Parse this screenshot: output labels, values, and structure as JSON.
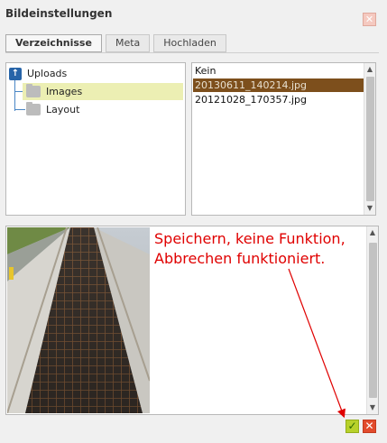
{
  "dialog": {
    "title": "Bildeinstellungen",
    "close_glyph": "✕"
  },
  "tabs": [
    {
      "label": "Verzeichnisse",
      "active": true
    },
    {
      "label": "Meta",
      "active": false
    },
    {
      "label": "Hochladen",
      "active": false
    }
  ],
  "tree": {
    "root": {
      "label": "Uploads",
      "icon": "upload-arrow-icon"
    },
    "children": [
      {
        "label": "Images",
        "icon": "folder-icon",
        "selected": true
      },
      {
        "label": "Layout",
        "icon": "folder-icon",
        "selected": false
      }
    ]
  },
  "files": {
    "items": [
      {
        "label": "Kein",
        "selected": false
      },
      {
        "label": "20130611_140214.jpg",
        "selected": true
      },
      {
        "label": "20121028_170357.jpg",
        "selected": false
      }
    ]
  },
  "annotation": {
    "line1": "Speichern, keine Funktion,",
    "line2": "Abbrechen funktioniert."
  },
  "buttons": {
    "ok_glyph": "✓",
    "cancel_glyph": "✕"
  },
  "colors": {
    "annotation": "#e00000",
    "selected_file": "#7d4f1c",
    "selected_folder": "#ecefb3",
    "ok": "#b7d12a",
    "cancel": "#e24b2c"
  }
}
